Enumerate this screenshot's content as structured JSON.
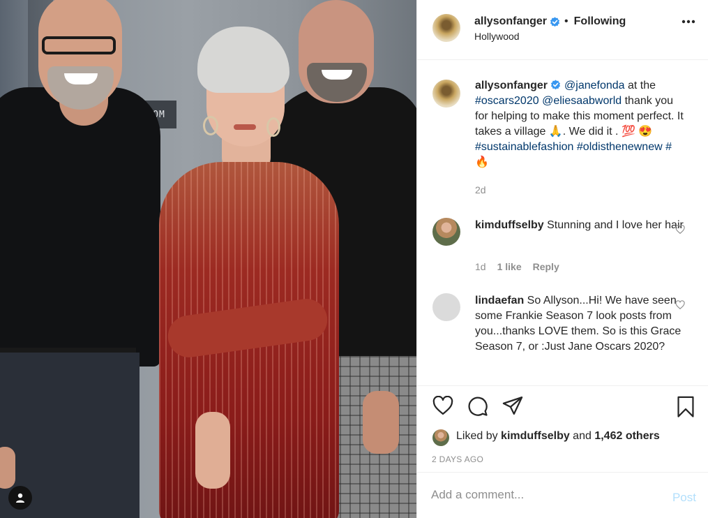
{
  "photo": {
    "sign_text": "RESTROOM"
  },
  "post": {
    "author": "allysonfanger",
    "separator": "•",
    "follow_status": "Following",
    "location": "Hollywood"
  },
  "caption": {
    "author": "allysonfanger",
    "mention1": "@janefonda",
    "t1": " at the ",
    "tag1": "#oscars2020",
    "t2": " ",
    "mention2": "@eliesaabworld",
    "t3": " thank you for helping to make this moment perfect. It takes a village 🙏. We did it . 💯 😍 ",
    "tag2": "#sustainablefashion",
    "t4": " ",
    "tag3": "#oldisthenewnew",
    "t5": " ",
    "tag4": "#🔥",
    "time": "2d"
  },
  "comments": [
    {
      "author": "kimduffselby",
      "text": " Stunning and I love her hair",
      "time": "1d",
      "likes": "1 like",
      "reply": "Reply"
    },
    {
      "author": "lindaefan",
      "text": " So Allyson...Hi! We have seen some Frankie Season 7 look posts from you...thanks LOVE them. So is this Grace Season 7, or :Just Jane Oscars 2020?"
    }
  ],
  "likes": {
    "prefix": "Liked by ",
    "user": "kimduffselby",
    "middle": " and ",
    "others": "1,462 others"
  },
  "timestamp": "2 DAYS AGO",
  "add_comment": {
    "placeholder": "Add a comment...",
    "post_label": "Post"
  },
  "colors": {
    "link": "#00376b",
    "verified": "#3897f0",
    "post_disabled": "#b2dffc"
  },
  "icons": [
    "heart-icon",
    "comment-icon",
    "share-icon",
    "bookmark-icon",
    "more-icon",
    "verified-badge-icon",
    "user-tag-icon"
  ]
}
